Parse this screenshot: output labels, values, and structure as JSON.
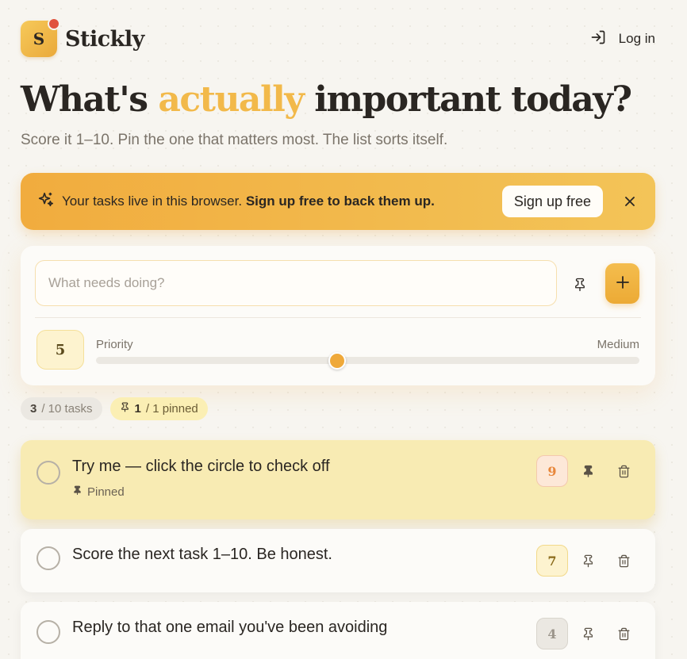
{
  "app": {
    "logo_letter": "S",
    "name": "Stickly"
  },
  "header": {
    "login_label": "Log in"
  },
  "hero": {
    "title_start": "What's ",
    "title_accent": "actually",
    "title_end": " important today?",
    "subtitle": "Score it 1–10. Pin the one that matters most. The list sorts itself."
  },
  "banner": {
    "text_plain": "Your tasks live in this browser. ",
    "text_bold": "Sign up free to back them up.",
    "signup_label": "Sign up free"
  },
  "composer": {
    "placeholder": "What needs doing?",
    "value": "",
    "score": "5",
    "priority_label": "Priority",
    "priority_level": "Medium",
    "slider_value": 5,
    "slider_min": 1,
    "slider_max": 10
  },
  "counters": {
    "tasks_count": "3",
    "tasks_total": "/ 10 tasks",
    "pinned_count": "1",
    "pinned_total": "/ 1 pinned"
  },
  "tasks": [
    {
      "title": "Try me — click the circle to check off",
      "meta": "Pinned",
      "score": "9",
      "pinned": true
    },
    {
      "title": "Score the next task 1–10. Be honest.",
      "score": "7",
      "pinned": false
    },
    {
      "title": "Reply to that one email you've been avoiding",
      "score": "4",
      "pinned": false
    }
  ],
  "colors": {
    "accent": "#f2b94a",
    "banner_start": "#f1ac3e",
    "banner_end": "#f3c458",
    "pinned_bg": "#f8ebb3",
    "logo_dot": "#e0523d"
  }
}
